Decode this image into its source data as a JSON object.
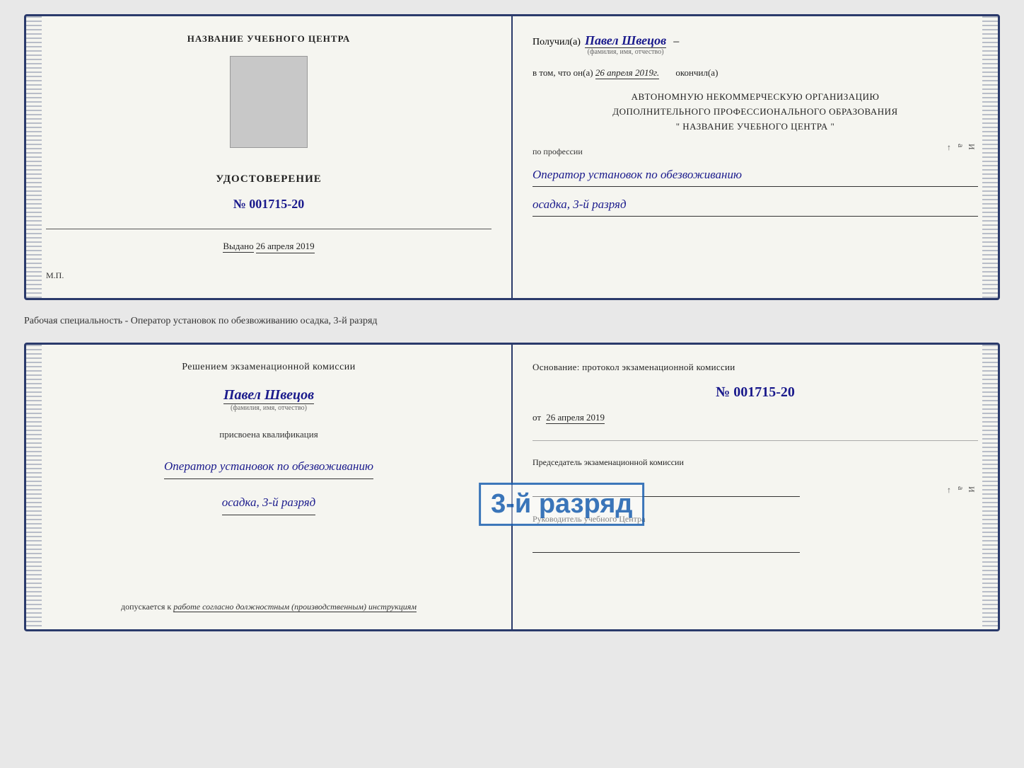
{
  "doc1": {
    "left": {
      "center_title": "НАЗВАНИЕ УЧЕБНОГО ЦЕНТРА",
      "cert_label": "УДОСТОВЕРЕНИЕ",
      "cert_number": "№ 001715-20",
      "issued_label": "Выдано",
      "issued_date": "26 апреля 2019",
      "mp_label": "М.П."
    },
    "right": {
      "received_prefix": "Получил(а)",
      "recipient_name": "Павел Швецов",
      "fio_label": "(фамилия, имя, отчество)",
      "completed_prefix": "в том, что он(а)",
      "completed_date": "26 апреля 2019г.",
      "completed_suffix": "окончил(а)",
      "org_line1": "АВТОНОМНУЮ НЕКОММЕРЧЕСКУЮ ОРГАНИЗАЦИЮ",
      "org_line2": "ДОПОЛНИТЕЛЬНОГО ПРОФЕССИОНАЛЬНОГО ОБРАЗОВАНИЯ",
      "org_line3": "\"   НАЗВАНИЕ УЧЕБНОГО ЦЕНТРА   \"",
      "profession_label": "по профессии",
      "profession_value": "Оператор установок по обезвоживанию",
      "rank_value": "осадка, 3-й разряд"
    }
  },
  "between_label": "Рабочая специальность - Оператор установок по обезвоживанию осадка, 3-й разряд",
  "doc2": {
    "left": {
      "decision_label": "Решением экзаменационной комиссии",
      "name": "Павел Швецов",
      "fio_label": "(фамилия, имя, отчество)",
      "qualification_label": "присвоена квалификация",
      "profession_value": "Оператор установок по обезвоживанию",
      "rank_value": "осадка, 3-й разряд",
      "допускается_label": "допускается к",
      "допускается_value": "работе согласно должностным (производственным) инструкциям"
    },
    "right": {
      "osnov_label": "Основание: протокол экзаменационной комиссии",
      "number": "№  001715-20",
      "date_prefix": "от",
      "date_value": "26 апреля 2019",
      "chairman_label": "Председатель экзаменационной комиссии",
      "руководитель_label": "Руководитель учебного Центра"
    },
    "stamp": "3-й разряд"
  },
  "right_edge": {
    "chars": "И а ←"
  }
}
